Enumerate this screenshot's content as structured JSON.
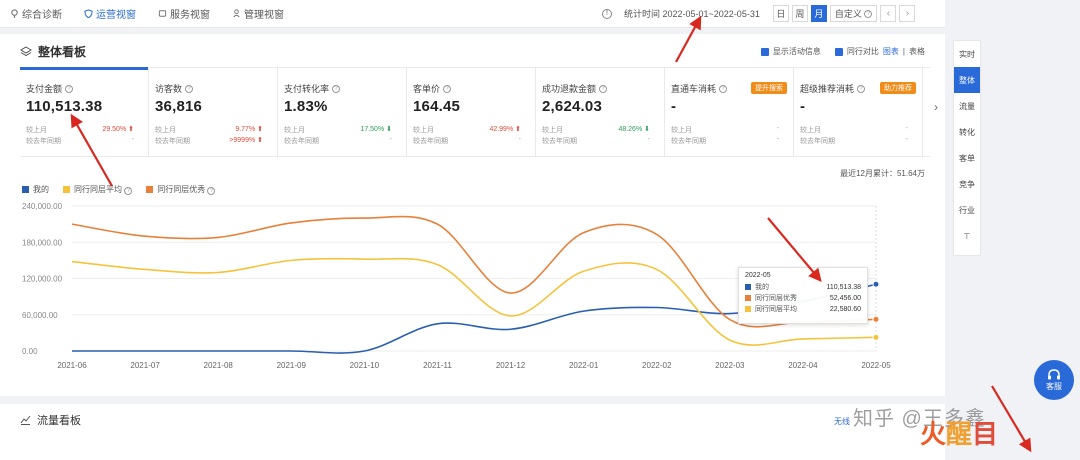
{
  "nav": {
    "tabs": [
      {
        "label": "综合诊断",
        "icon": "location-icon"
      },
      {
        "label": "运营视窗",
        "icon": "shield-icon"
      },
      {
        "label": "服务视窗",
        "icon": "service-icon"
      },
      {
        "label": "管理视窗",
        "icon": "manage-icon"
      }
    ],
    "active_tab": "运营视窗",
    "period_label": "统计时间 2022-05-01~2022-05-31",
    "period_buttons": [
      "日",
      "周",
      "月"
    ],
    "period_active": "月",
    "custom_label": "自定义"
  },
  "overview": {
    "title": "整体看板",
    "opt_show_activity": "显示活动信息",
    "opt_peer_compare": "同行对比",
    "view_chart": "图表",
    "view_sep": "|",
    "view_table": "表格",
    "metrics": [
      {
        "label": "支付金额",
        "value": "110,513.38",
        "row1_label": "较上月",
        "row1_value": "29.50%",
        "row1_dir": "up",
        "row2_label": "较去年同期",
        "row2_value": "-"
      },
      {
        "label": "访客数",
        "value": "36,816",
        "row1_label": "较上月",
        "row1_value": "9.77%",
        "row1_dir": "up",
        "row2_label": "较去年同期",
        "row2_value": ">9999%",
        "row2_dir": "up"
      },
      {
        "label": "支付转化率",
        "value": "1.83%",
        "row1_label": "较上月",
        "row1_value": "17.50%",
        "row1_dir": "down",
        "row2_label": "较去年同期",
        "row2_value": "-"
      },
      {
        "label": "客单价",
        "value": "164.45",
        "row1_label": "较上月",
        "row1_value": "42.99%",
        "row1_dir": "up",
        "row2_label": "较去年同期",
        "row2_value": "-"
      },
      {
        "label": "成功退款金额",
        "value": "2,624.03",
        "row1_label": "较上月",
        "row1_value": "48.26%",
        "row1_dir": "down",
        "row2_label": "较去年同期",
        "row2_value": "-"
      },
      {
        "label": "直通车消耗",
        "value": "-",
        "tag": "提升搜索",
        "row1_label": "较上月",
        "row1_value": "-",
        "row2_label": "较去年同期",
        "row2_value": "-"
      },
      {
        "label": "超级推荐消耗",
        "value": "-",
        "tag": "助力推荐",
        "row1_label": "较上月",
        "row1_value": "-",
        "row2_label": "较去年同期",
        "row2_value": "-"
      }
    ],
    "sum_label": "最近12月累计：51.64万"
  },
  "chart_data": {
    "type": "line",
    "categories": [
      "2021-06",
      "2021-07",
      "2021-08",
      "2021-09",
      "2021-10",
      "2021-11",
      "2021-12",
      "2022-01",
      "2022-02",
      "2022-03",
      "2022-04",
      "2022-05"
    ],
    "series": [
      {
        "name": "我的",
        "color": "#2a5fb0",
        "values": [
          0,
          0,
          0,
          0,
          0,
          45000,
          36000,
          66000,
          72000,
          62000,
          82000,
          110513.38
        ]
      },
      {
        "name": "同行同层平均",
        "color": "#f5c33b",
        "values": [
          148000,
          135000,
          130000,
          150000,
          152000,
          143000,
          58000,
          132000,
          135000,
          18000,
          20000,
          22580.6
        ]
      },
      {
        "name": "同行同层优秀",
        "color": "#e8803a",
        "values": [
          210000,
          190000,
          188000,
          212000,
          220000,
          210000,
          96000,
          196000,
          193000,
          52000,
          48000,
          52456
        ]
      }
    ],
    "y_ticks": [
      "0.00",
      "60,000.00",
      "120,000.00",
      "180,000.00",
      "240,000.00"
    ],
    "ylim": [
      0,
      240000
    ],
    "grid": true,
    "legend": "top-left",
    "tooltip": {
      "title": "2022-05",
      "rows": [
        {
          "name": "我的",
          "value": "110,513.38",
          "color": "#2a5fb0"
        },
        {
          "name": "同行同层优秀",
          "value": "52,456.00",
          "color": "#e8803a"
        },
        {
          "name": "同行同层平均",
          "value": "22,580.60",
          "color": "#f5c33b"
        }
      ]
    }
  },
  "flow": {
    "title": "流量看板",
    "link": "无线"
  },
  "sidenav": {
    "items": [
      "实时",
      "整体",
      "流量",
      "转化",
      "客单",
      "竞争",
      "行业",
      "⊤"
    ],
    "active": "整体"
  },
  "service": {
    "label": "客服"
  },
  "watermark": "知乎 @王多鑫",
  "brand": {
    "c1": "火",
    "c2": "醒",
    "c3": "目"
  }
}
